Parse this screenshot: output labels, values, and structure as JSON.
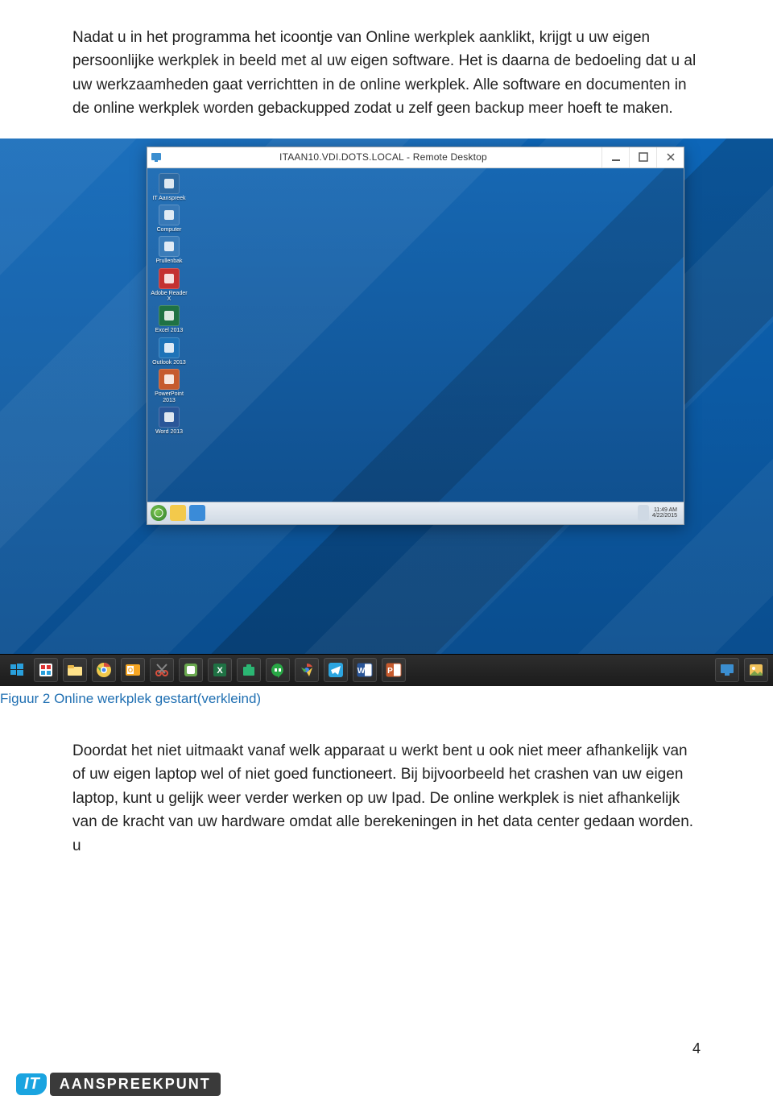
{
  "paragraphs": {
    "p1": "Nadat u in het programma het icoontje van Online werkplek aanklikt, krijgt u uw eigen persoonlijke werkplek in beeld met al uw eigen software. Het is daarna de bedoeling dat u al uw werkzaamheden gaat verrichtten in de online werkplek. Alle software en documenten in de online werkplek worden gebackupped zodat u zelf geen backup meer hoeft te maken.",
    "p2": "Doordat het niet uitmaakt vanaf welk apparaat u werkt bent u ook niet meer afhankelijk van of uw eigen laptop wel of niet goed functioneert. Bij bijvoorbeeld het crashen van uw eigen laptop, kunt u gelijk weer verder werken op uw Ipad. De online werkplek is niet afhankelijk van de kracht van uw hardware omdat alle berekeningen in het data center gedaan worden. u"
  },
  "figure": {
    "caption": "Figuur 2 Online werkplek gestart(verkleind)",
    "remote_window": {
      "title": "ITAAN10.VDI.DOTS.LOCAL - Remote Desktop",
      "desktop_icons": [
        {
          "label": "IT Aanspreek",
          "color": "#2d6aa3"
        },
        {
          "label": "Computer",
          "color": "#3879b7"
        },
        {
          "label": "Prullenbak",
          "color": "#3a7cb9"
        },
        {
          "label": "Adobe Reader X",
          "color": "#c43131"
        },
        {
          "label": "Excel 2013",
          "color": "#1f7244"
        },
        {
          "label": "Outlook 2013",
          "color": "#1e73b8"
        },
        {
          "label": "PowerPoint 2013",
          "color": "#c65a2d"
        },
        {
          "label": "Word 2013",
          "color": "#2a5699"
        }
      ],
      "inner_taskbar": {
        "start": "start",
        "clock": {
          "time": "11:49 AM",
          "date": "4/22/2015"
        }
      }
    },
    "outer_taskbar_icons": [
      "start-icon",
      "tiles-icon",
      "explorer-icon",
      "chrome-icon",
      "outlook-icon",
      "snip-icon",
      "vmware-icon",
      "excel-icon",
      "store-icon",
      "hangouts-icon",
      "chrome-app-icon",
      "telegram-icon",
      "word-icon",
      "powerpoint-icon",
      "remote-desktop-icon",
      "picture-icon"
    ]
  },
  "page_number": "4",
  "footer": {
    "it": "IT",
    "brand": "AANSPREEKPUNT"
  }
}
